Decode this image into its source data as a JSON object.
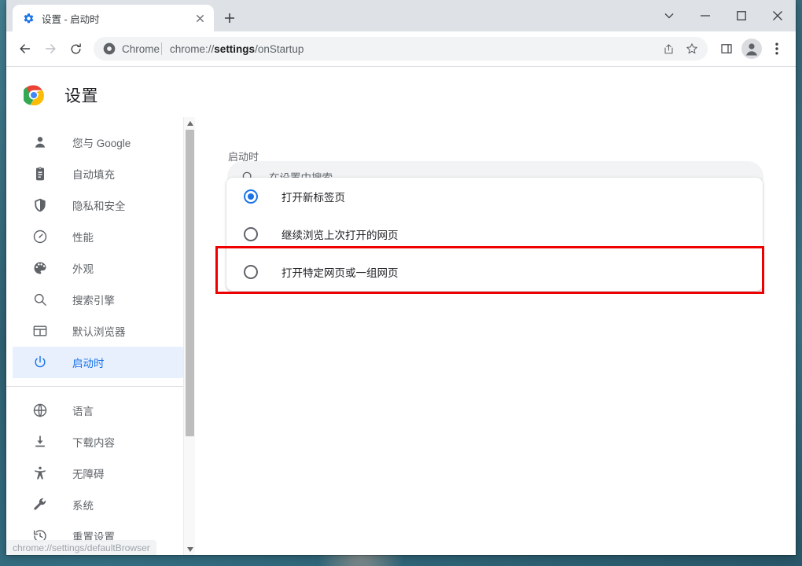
{
  "window": {
    "controls": [
      {
        "name": "tab-search-button",
        "glyph": "chevron-down-icon"
      },
      {
        "name": "minimize-button",
        "glyph": "minimize-icon"
      },
      {
        "name": "maximize-button",
        "glyph": "maximize-icon"
      },
      {
        "name": "close-button",
        "glyph": "close-icon"
      }
    ]
  },
  "tab": {
    "title": "设置 - 启动时",
    "favicon": "settings-gear-icon",
    "close_label": "×",
    "newtab_label": "+"
  },
  "toolbar": {
    "back": "back-arrow-icon",
    "forward": "forward-arrow-icon",
    "reload": "reload-icon",
    "omnibox": {
      "chip_label": "Chrome",
      "chip_icon": "chrome-icon",
      "url_prefix": "chrome://",
      "url_bold": "settings",
      "url_suffix": "/onStartup"
    },
    "actions": [
      {
        "name": "share-icon"
      },
      {
        "name": "bookmark-star-icon"
      },
      {
        "name": "side-panel-icon"
      },
      {
        "name": "profile-avatar"
      },
      {
        "name": "more-menu-icon"
      }
    ]
  },
  "settings": {
    "logo": "chrome-logo",
    "title": "设置",
    "search": {
      "placeholder": "在设置中搜索",
      "icon": "search-icon"
    }
  },
  "sidebar": {
    "groups": [
      {
        "items": [
          {
            "label": "您与 Google",
            "icon": "person-icon",
            "active": false
          },
          {
            "label": "自动填充",
            "icon": "clipboard-icon",
            "active": false
          },
          {
            "label": "隐私和安全",
            "icon": "shield-icon",
            "active": false
          },
          {
            "label": "性能",
            "icon": "speedometer-icon",
            "active": false
          },
          {
            "label": "外观",
            "icon": "palette-icon",
            "active": false
          },
          {
            "label": "搜索引擎",
            "icon": "search-icon",
            "active": false
          },
          {
            "label": "默认浏览器",
            "icon": "browser-window-icon",
            "active": false
          },
          {
            "label": "启动时",
            "icon": "power-icon",
            "active": true
          }
        ]
      },
      {
        "items": [
          {
            "label": "语言",
            "icon": "globe-icon",
            "active": false
          },
          {
            "label": "下载内容",
            "icon": "download-icon",
            "active": false
          },
          {
            "label": "无障碍",
            "icon": "accessibility-icon",
            "active": false
          },
          {
            "label": "系统",
            "icon": "wrench-icon",
            "active": false
          },
          {
            "label": "重置设置",
            "icon": "history-restore-icon",
            "active": false
          }
        ]
      }
    ]
  },
  "main": {
    "section_title": "启动时",
    "options": [
      {
        "label": "打开新标签页",
        "selected": true
      },
      {
        "label": "继续浏览上次打开的网页",
        "selected": false
      },
      {
        "label": "打开特定网页或一组网页",
        "selected": false
      }
    ]
  },
  "status": {
    "text": "chrome://settings/defaultBrowser"
  },
  "annotation": {
    "color": "#ee0000",
    "target": "打开新标签页"
  }
}
